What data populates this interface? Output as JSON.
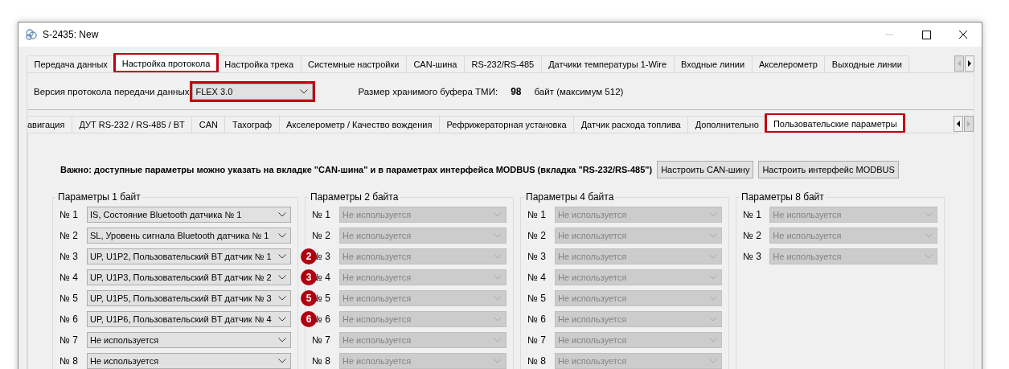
{
  "window": {
    "title": "S-2435: New"
  },
  "main_tabs": [
    {
      "label": "Передача данных",
      "selected": false,
      "highlighted": false
    },
    {
      "label": "Настройка протокола",
      "selected": true,
      "highlighted": true
    },
    {
      "label": "Настройка трека",
      "selected": false,
      "highlighted": false
    },
    {
      "label": "Системные настройки",
      "selected": false,
      "highlighted": false
    },
    {
      "label": "CAN-шина",
      "selected": false,
      "highlighted": false
    },
    {
      "label": "RS-232/RS-485",
      "selected": false,
      "highlighted": false
    },
    {
      "label": "Датчики температуры 1-Wire",
      "selected": false,
      "highlighted": false
    },
    {
      "label": "Входные линии",
      "selected": false,
      "highlighted": false
    },
    {
      "label": "Акселерометр",
      "selected": false,
      "highlighted": false
    },
    {
      "label": "Выходные линии",
      "selected": false,
      "highlighted": false
    }
  ],
  "main_tabs_scroll": {
    "left_enabled": false,
    "right_enabled": true
  },
  "protocol": {
    "label": "Версия протокола передачи данных",
    "version": {
      "value": "FLEX 3.0",
      "highlighted": true
    },
    "buffer_label": "Размер хранимого буфера ТМИ:",
    "buffer_value": "98",
    "buffer_note": "байт (максимум 512)"
  },
  "sub_tabs": [
    {
      "label": "авигация",
      "selected": false,
      "highlighted": false
    },
    {
      "label": "ДУТ RS-232 / RS-485 / BT",
      "selected": false,
      "highlighted": false
    },
    {
      "label": "CAN",
      "selected": false,
      "highlighted": false
    },
    {
      "label": "Тахограф",
      "selected": false,
      "highlighted": false
    },
    {
      "label": "Акселерометр / Качество вождения",
      "selected": false,
      "highlighted": false
    },
    {
      "label": "Рефрижераторная установка",
      "selected": false,
      "highlighted": false
    },
    {
      "label": "Датчик расхода топлива",
      "selected": false,
      "highlighted": false
    },
    {
      "label": "Дополнительно",
      "selected": false,
      "highlighted": false
    },
    {
      "label": "Пользовательские параметры",
      "selected": true,
      "highlighted": true
    }
  ],
  "sub_tabs_scroll": {
    "left_enabled": true,
    "right_enabled": false
  },
  "notice": "Важно: доступные параметры можно указать на вкладке \"CAN-шина\" и в параметрах интерфейса MODBUS (вкладка \"RS-232/RS-485\")",
  "buttons": [
    "Настроить CAN-шину",
    "Настроить интерфейс MODBUS"
  ],
  "groups": [
    {
      "title": "Параметры 1 байт",
      "disabled": false,
      "rows": [
        {
          "label": "№ 1",
          "value": "IS, Состояние Bluetooth датчика № 1"
        },
        {
          "label": "№ 2",
          "value": "SL, Уровень сигнала Bluetooth датчика № 1"
        },
        {
          "label": "№ 3",
          "value": "UP, U1P2, Пользовательский BT датчик № 1",
          "marker": "2"
        },
        {
          "label": "№ 4",
          "value": "UP, U1P3, Пользовательский BT датчик № 2",
          "marker": "3"
        },
        {
          "label": "№ 5",
          "value": "UP, U1P5, Пользовательский BT датчик № 3",
          "marker": "5"
        },
        {
          "label": "№ 6",
          "value": "UP, U1P6, Пользовательский BT датчик № 4",
          "marker": "6"
        },
        {
          "label": "№ 7",
          "value": "Не используется"
        },
        {
          "label": "№ 8",
          "value": "Не используется"
        }
      ]
    },
    {
      "title": "Параметры 2 байта",
      "disabled": true,
      "rows": [
        {
          "label": "№ 1",
          "value": "Не используется"
        },
        {
          "label": "№ 2",
          "value": "Не используется"
        },
        {
          "label": "№ 3",
          "value": "Не используется"
        },
        {
          "label": "№ 4",
          "value": "Не используется"
        },
        {
          "label": "№ 5",
          "value": "Не используется"
        },
        {
          "label": "№ 6",
          "value": "Не используется"
        },
        {
          "label": "№ 7",
          "value": "Не используется"
        },
        {
          "label": "№ 8",
          "value": "Не используется"
        }
      ]
    },
    {
      "title": "Параметры 4 байта",
      "disabled": true,
      "rows": [
        {
          "label": "№ 1",
          "value": "Не используется"
        },
        {
          "label": "№ 2",
          "value": "Не используется"
        },
        {
          "label": "№ 3",
          "value": "Не используется"
        },
        {
          "label": "№ 4",
          "value": "Не используется"
        },
        {
          "label": "№ 5",
          "value": "Не используется"
        },
        {
          "label": "№ 6",
          "value": "Не используется"
        },
        {
          "label": "№ 7",
          "value": "Не используется"
        },
        {
          "label": "№ 8",
          "value": "Не используется"
        }
      ]
    },
    {
      "title": "Параметры 8 байт",
      "disabled": true,
      "rows": [
        {
          "label": "№ 1",
          "value": "Не используется"
        },
        {
          "label": "№ 2",
          "value": "Не используется"
        },
        {
          "label": "№ 3",
          "value": "Не используется"
        }
      ]
    }
  ]
}
